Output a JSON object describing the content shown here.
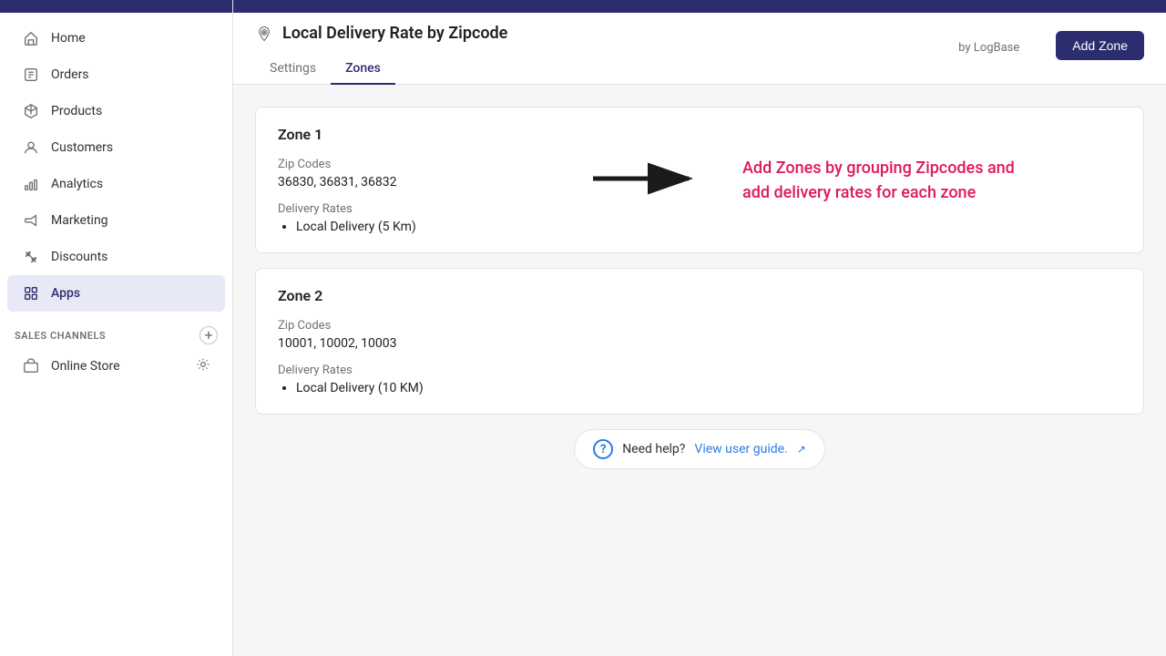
{
  "topbar": {
    "color": "#2c2d6e"
  },
  "sidebar": {
    "items": [
      {
        "id": "home",
        "label": "Home",
        "icon": "home-icon",
        "active": false
      },
      {
        "id": "orders",
        "label": "Orders",
        "icon": "orders-icon",
        "active": false
      },
      {
        "id": "products",
        "label": "Products",
        "icon": "products-icon",
        "active": false
      },
      {
        "id": "customers",
        "label": "Customers",
        "icon": "customers-icon",
        "active": false
      },
      {
        "id": "analytics",
        "label": "Analytics",
        "icon": "analytics-icon",
        "active": false
      },
      {
        "id": "marketing",
        "label": "Marketing",
        "icon": "marketing-icon",
        "active": false
      },
      {
        "id": "discounts",
        "label": "Discounts",
        "icon": "discounts-icon",
        "active": false
      },
      {
        "id": "apps",
        "label": "Apps",
        "icon": "apps-icon",
        "active": true
      }
    ],
    "sales_channels_label": "SALES CHANNELS",
    "online_store_label": "Online Store"
  },
  "header": {
    "app_icon_alt": "delivery-icon",
    "title": "Local Delivery Rate by Zipcode",
    "by_label": "by LogBase",
    "tabs": [
      {
        "id": "settings",
        "label": "Settings",
        "active": false
      },
      {
        "id": "zones",
        "label": "Zones",
        "active": true
      }
    ],
    "add_zone_button": "Add Zone"
  },
  "zones": [
    {
      "id": "zone1",
      "title": "Zone 1",
      "zip_codes_label": "Zip Codes",
      "zip_codes_value": "36830, 36831, 36832",
      "delivery_rates_label": "Delivery Rates",
      "delivery_rates": [
        "Local Delivery (5 Km)"
      ],
      "callout": "Add Zones by grouping Zipcodes and add delivery rates for each zone"
    },
    {
      "id": "zone2",
      "title": "Zone 2",
      "zip_codes_label": "Zip Codes",
      "zip_codes_value": "10001, 10002, 10003",
      "delivery_rates_label": "Delivery Rates",
      "delivery_rates": [
        "Local Delivery (10 KM)"
      ]
    }
  ],
  "help": {
    "text": "Need help?",
    "link_label": "View user guide.",
    "link_url": "#"
  }
}
